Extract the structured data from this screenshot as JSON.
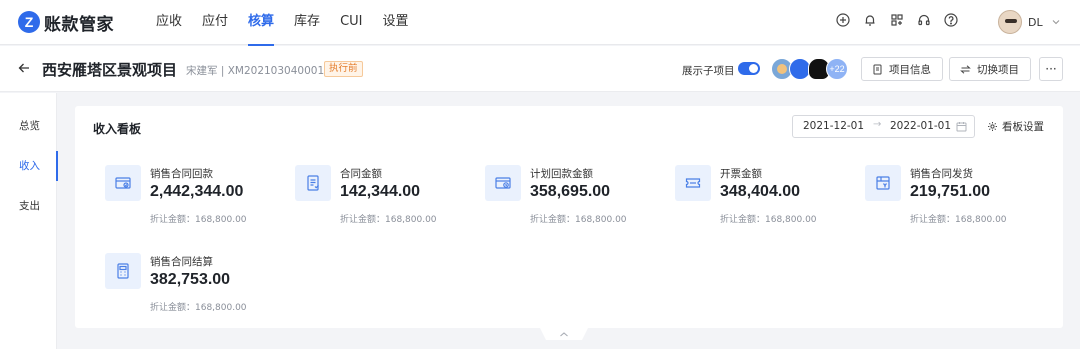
{
  "app": {
    "logo_mark": "Z",
    "name": "账款管家"
  },
  "nav": {
    "items": [
      {
        "label": "应收",
        "active": false
      },
      {
        "label": "应付",
        "active": false
      },
      {
        "label": "核算",
        "active": true
      },
      {
        "label": "库存",
        "active": false
      },
      {
        "label": "CUI",
        "active": false
      },
      {
        "label": "设置",
        "active": false
      }
    ],
    "tool_icons": [
      "plus-circle-icon",
      "bell-icon",
      "apps-grid-icon",
      "headset-icon",
      "help-circle-icon"
    ]
  },
  "user": {
    "name": "DL"
  },
  "project": {
    "title": "西安雁塔区景观项目",
    "meta": "宋建军 | XM202103040001",
    "status_badge": "执行前",
    "show_sub_label": "展示子项目",
    "show_sub_enabled": true,
    "member_more": "+22",
    "info_button": "项目信息",
    "switch_button": "切换项目",
    "more_button": "···"
  },
  "sidebar": {
    "items": [
      {
        "label": "总览",
        "active": false
      },
      {
        "label": "收入",
        "active": true
      },
      {
        "label": "支出",
        "active": false
      }
    ]
  },
  "board": {
    "title": "收入看板",
    "date_start": "2021-12-01",
    "date_arrow": "→",
    "date_end": "2022-01-01",
    "settings_label": "看板设置",
    "metrics": [
      {
        "label": "销售合同回款",
        "value": "2,442,344.00",
        "sub": "折让金额：168,800.00",
        "icon": "receipt-payment-icon"
      },
      {
        "label": "合同金额",
        "value": "142,344.00",
        "sub": "折让金额：168,800.00",
        "icon": "contract-document-icon"
      },
      {
        "label": "计划回款金额",
        "value": "358,695.00",
        "sub": "折让金额：168,800.00",
        "icon": "planned-payment-icon"
      },
      {
        "label": "开票金额",
        "value": "348,404.00",
        "sub": "折让金额：168,800.00",
        "icon": "invoice-ticket-icon"
      },
      {
        "label": "销售合同发货",
        "value": "219,751.00",
        "sub": "折让金额：168,800.00",
        "icon": "shipment-icon"
      },
      {
        "label": "销售合同结算",
        "value": "382,753.00",
        "sub": "折让金额：168,800.00",
        "icon": "settlement-calculator-icon"
      }
    ]
  },
  "colors": {
    "accent": "#2f6bea",
    "badge": "#e47d2c",
    "icon_bg": "#eaf1fd"
  }
}
